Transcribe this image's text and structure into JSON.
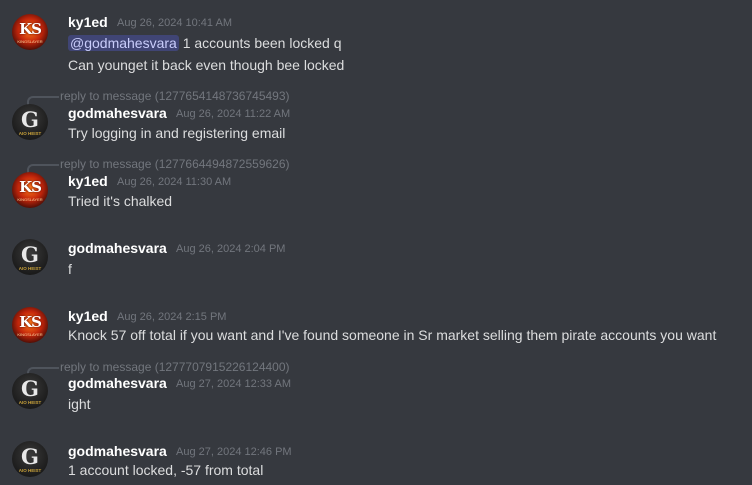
{
  "messages": [
    {
      "author": "ky1ed",
      "avatar": "ks-avatar",
      "timestamp": "Aug 26, 2024 10:41 AM",
      "mention": "@godmahesvara",
      "lines": [
        "1 accounts been locked q",
        "Can younget it back even though bee locked"
      ]
    },
    {
      "reply": "reply to message (1277654148736745493)",
      "author": "godmahesvara",
      "avatar": "g-avatar",
      "timestamp": "Aug 26, 2024 11:22 AM",
      "lines": [
        "Try logging in and registering email"
      ]
    },
    {
      "reply": "reply to message (1277664494872559626)",
      "author": "ky1ed",
      "avatar": "ks-avatar",
      "timestamp": "Aug 26, 2024 11:30 AM",
      "lines": [
        "Tried it's chalked"
      ]
    },
    {
      "author": "godmahesvara",
      "avatar": "g-avatar",
      "timestamp": "Aug 26, 2024 2:04 PM",
      "lines": [
        "f"
      ]
    },
    {
      "author": "ky1ed",
      "avatar": "ks-avatar",
      "timestamp": "Aug 26, 2024 2:15 PM",
      "lines": [
        "Knock 57 off total if you want and I've found someone in Sr market selling them pirate accounts you want"
      ]
    },
    {
      "reply": "reply to message (1277707915226124400)",
      "author": "godmahesvara",
      "avatar": "g-avatar",
      "timestamp": "Aug 27, 2024 12:33 AM",
      "lines": [
        "ight"
      ]
    },
    {
      "author": "godmahesvara",
      "avatar": "g-avatar",
      "timestamp": "Aug 27, 2024 12:46 PM",
      "lines": [
        "1 account locked, -57 from total"
      ]
    }
  ],
  "avatars": {
    "ks": {
      "monogram": "KS",
      "subtext": "KINGSLAYER"
    },
    "g": {
      "monogram": "G",
      "subtext": "AIO HEIST"
    }
  },
  "colors": {
    "background": "#36393f",
    "username": "#ffffff",
    "timestamp": "#72767d",
    "text": "#dcddde",
    "mention_bg": "#5865f2"
  }
}
